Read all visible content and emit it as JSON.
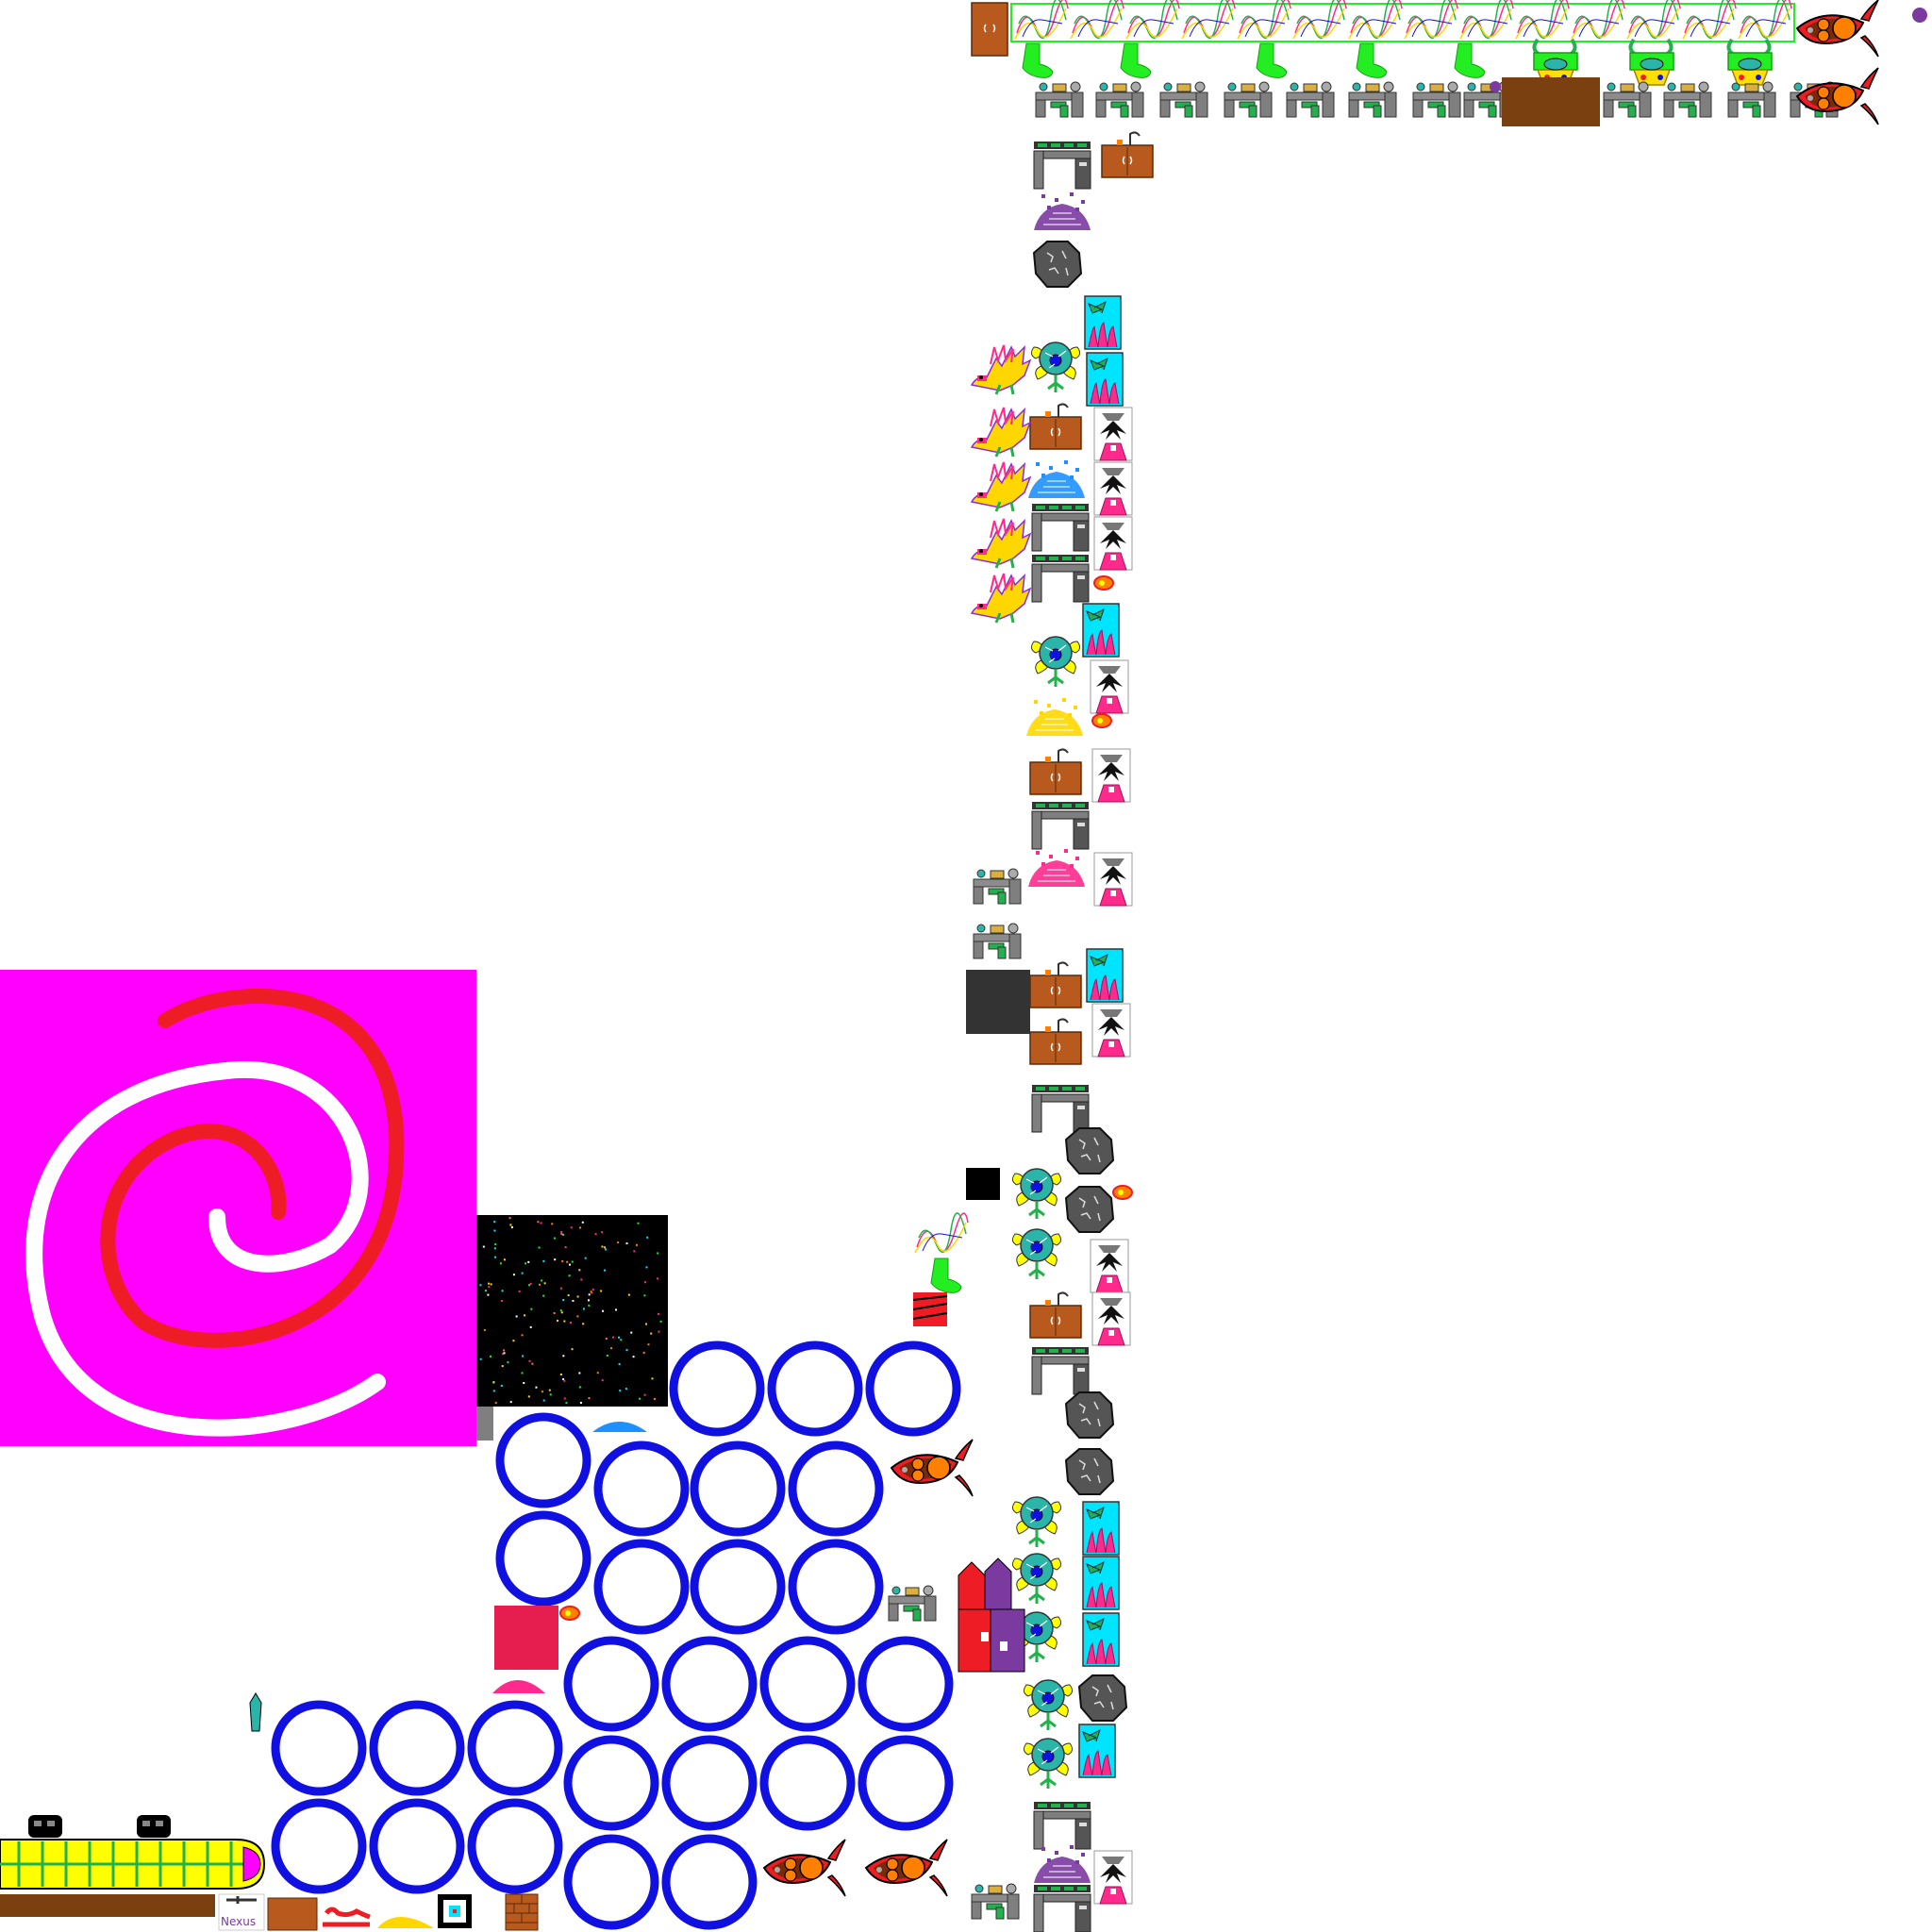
{
  "sprite_sheet": {
    "background": "#ffffff",
    "colors": {
      "portal_magenta": "#ff00ff",
      "spiral_red": "#ee1c24",
      "spiral_white": "#ffffff",
      "space_black": "#000000",
      "ring_blue": "#1010e0",
      "wood_brown": "#b85a1e",
      "dark_brown": "#7a4010",
      "machine_gray": "#7f7f7f",
      "pipe_green": "#22b14c",
      "sock_green": "#22ee22",
      "alien_teal": "#2bb4a8",
      "crystal_cyan": "#00e5ff",
      "coral_pink": "#ff2a8c",
      "boulder_gray": "#555555",
      "ember_orange": "#ff8000",
      "bus_yellow": "#ffff00",
      "blanket_pink": "#e61e50"
    },
    "icons": [
      "spiral-portal-icon",
      "starfield-icon",
      "portal-ring-icon",
      "rocket-pod-icon",
      "lab-machine-icon",
      "wooden-door-icon",
      "cabinet-icon",
      "green-sock-icon",
      "flower-pot-icon",
      "alien-flower-icon",
      "aquarium-icon",
      "vase-creature-icon",
      "boulder-icon",
      "gem-pile-icon",
      "dragon-icon",
      "bus-icon",
      "rainbow-scribble-icon"
    ],
    "nexus_sign": "Nexus"
  }
}
